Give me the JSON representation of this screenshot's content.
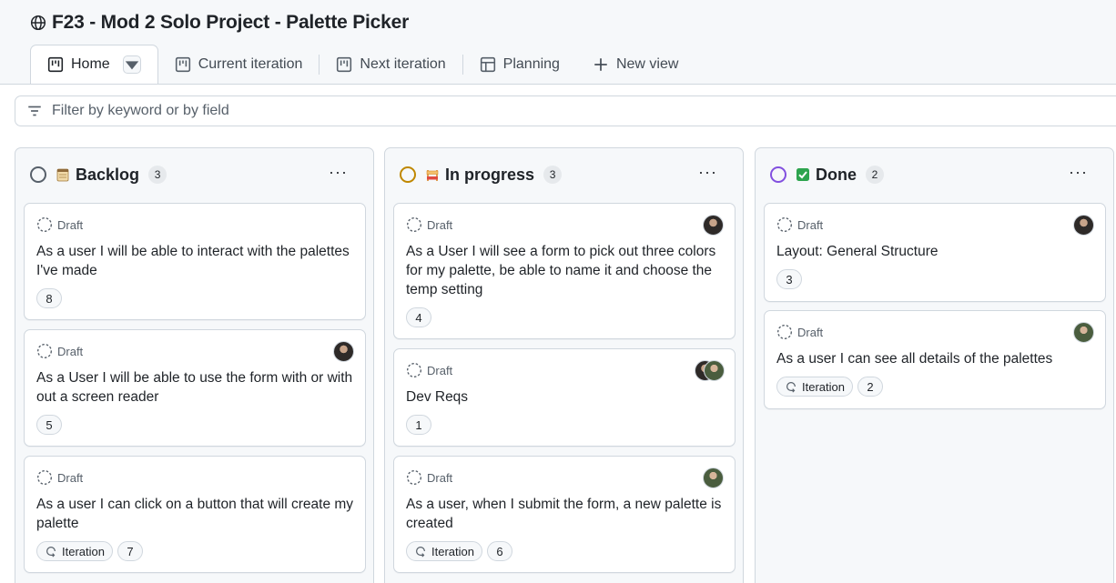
{
  "project": {
    "title": "F23 - Mod 2 Solo Project - Palette Picker"
  },
  "tabs": [
    {
      "label": "Home"
    },
    {
      "label": "Current iteration"
    },
    {
      "label": "Next iteration"
    },
    {
      "label": "Planning"
    },
    {
      "label": "New view"
    }
  ],
  "filter": {
    "placeholder": "Filter by keyword or by field"
  },
  "columns": [
    {
      "name": "Backlog",
      "count": "3",
      "status_color": "#57606a",
      "emoji": "notepad",
      "cards": [
        {
          "status": "Draft",
          "title": "As a user I will be able to interact with the palettes I've made",
          "estimate": "8"
        },
        {
          "status": "Draft",
          "title": "As a User I will be able to use the form with or with out a screen reader",
          "estimate": "5"
        },
        {
          "status": "Draft",
          "title": "As a user I can click on a button that will create my palette",
          "iteration": "Iteration",
          "estimate": "7"
        }
      ]
    },
    {
      "name": "In progress",
      "count": "3",
      "status_color": "#bf8700",
      "emoji": "construction",
      "cards": [
        {
          "status": "Draft",
          "title": "As a User I will see a form to pick out three colors for my palette, be able to name it and choose the temp setting",
          "estimate": "4"
        },
        {
          "status": "Draft",
          "title": "Dev Reqs",
          "estimate": "1"
        },
        {
          "status": "Draft",
          "title": "As a user, when I submit the form, a new palette is created",
          "iteration": "Iteration",
          "estimate": "6"
        }
      ]
    },
    {
      "name": "Done",
      "count": "2",
      "status_color": "#8250df",
      "emoji": "check-mark",
      "cards": [
        {
          "status": "Draft",
          "title": "Layout: General Structure",
          "estimate": "3"
        },
        {
          "status": "Draft",
          "title": "As a user I can see all details of the palettes",
          "iteration": "Iteration",
          "estimate": "2"
        }
      ]
    }
  ],
  "column_menu": "···"
}
